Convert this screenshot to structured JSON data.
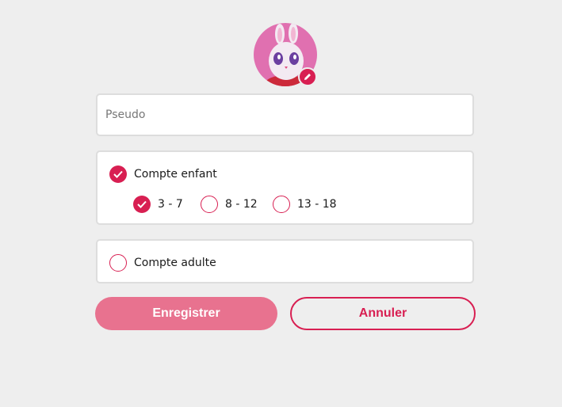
{
  "profile": {
    "avatar_icon": "bunny-avatar",
    "edit_icon": "pencil-icon"
  },
  "pseudo": {
    "placeholder": "Pseudo",
    "value": ""
  },
  "child_account": {
    "label": "Compte enfant",
    "checked": true,
    "age_ranges": [
      {
        "label": "3 - 7",
        "checked": true
      },
      {
        "label": "8 - 12",
        "checked": false
      },
      {
        "label": "13 - 18",
        "checked": false
      }
    ]
  },
  "adult_account": {
    "label": "Compte adulte",
    "checked": false
  },
  "actions": {
    "save_label": "Enregistrer",
    "cancel_label": "Annuler"
  },
  "colors": {
    "accent": "#d81f52",
    "save_button": "#e8728f",
    "avatar_bg": "#e070b0",
    "background": "#eeeeee"
  }
}
